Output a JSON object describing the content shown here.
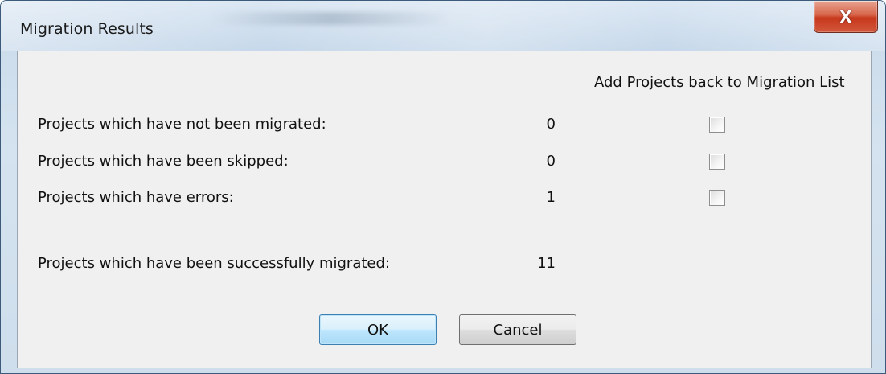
{
  "window": {
    "title": "Migration Results",
    "close_label": "X"
  },
  "header": {
    "checkbox_column_label": "Add Projects back to Migration List"
  },
  "rows": [
    {
      "label": "Projects which have not been migrated:",
      "count": "0",
      "checked": false
    },
    {
      "label": "Projects which have been skipped:",
      "count": "0",
      "checked": false
    },
    {
      "label": "Projects which have errors:",
      "count": "1",
      "checked": false
    }
  ],
  "success": {
    "label": "Projects which have been successfully migrated:",
    "count": "11"
  },
  "buttons": {
    "ok_label": "OK",
    "cancel_label": "Cancel"
  },
  "colors": {
    "client_bg": "#f0f0f0",
    "close_button": "#c7381c",
    "default_button_border": "#3c7fb1"
  }
}
